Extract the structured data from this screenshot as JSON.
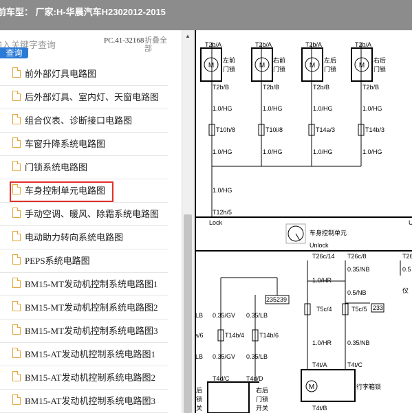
{
  "window": {
    "title": "前车型：  厂家:H-华晨汽车H2302012-2015"
  },
  "search": {
    "placeholder": "输入关键字查询",
    "button_label": "查询"
  },
  "page_code": "PC.41-32168",
  "collapse_label": "折叠全部",
  "tree_items": [
    {
      "label": "前外部灯具电路图",
      "selected": false
    },
    {
      "label": "后外部灯具、室内灯、天窗电路图",
      "selected": false
    },
    {
      "label": "组合仪表、诊断接口电路图",
      "selected": false
    },
    {
      "label": "车窗升降系统电路图",
      "selected": false
    },
    {
      "label": "门锁系统电路图",
      "selected": false
    },
    {
      "label": "车身控制单元电路图",
      "selected": true
    },
    {
      "label": "手动空调、暖风、除霜系统电路图",
      "selected": false
    },
    {
      "label": "电动助力转向系统电路图",
      "selected": false
    },
    {
      "label": "PEPS系统电路图",
      "selected": false
    },
    {
      "label": "BM15-MT发动机控制系统电路图1",
      "selected": false
    },
    {
      "label": "BM15-MT发动机控制系统电路图2",
      "selected": false
    },
    {
      "label": "BM15-MT发动机控制系统电路图3",
      "selected": false
    },
    {
      "label": "BM15-AT发动机控制系统电路图1",
      "selected": false
    },
    {
      "label": "BM15-AT发动机控制系统电路图2",
      "selected": false
    },
    {
      "label": "BM15-AT发动机控制系统电路图3",
      "selected": false
    }
  ],
  "diagram": {
    "motors": [
      {
        "top_pin": "T2b/A",
        "name_l1": "左前",
        "name_l2": "门锁",
        "bottom_pin": "T2b/B",
        "wire1": "1.0/HG",
        "fuse": "T10h/8",
        "wire2": "1.0/HG"
      },
      {
        "top_pin": "T2b/A",
        "name_l1": "右前",
        "name_l2": "门锁",
        "bottom_pin": "T2b/B",
        "wire1": "1.0/HG",
        "fuse": "T10i/8",
        "wire2": "1.0/HG"
      },
      {
        "top_pin": "T2b/A",
        "name_l1": "左后",
        "name_l2": "门锁",
        "bottom_pin": "T2b/B",
        "wire1": "1.0/HG",
        "fuse": "T14a/3",
        "wire2": "1.0/HG"
      },
      {
        "top_pin": "T2b/A",
        "name_l1": "右后",
        "name_l2": "门锁",
        "bottom_pin": "T2b/B",
        "wire1": "1.0/HG",
        "fuse": "T14b/3",
        "wire2": "1.0/HG"
      }
    ],
    "left_wire": "1.0/HG",
    "lock_pin": "T12h/5",
    "lock_label": "Lock",
    "unlock_label": "Unlock",
    "right_u": "U",
    "module_label": "车身控制单元",
    "conn_t26c14": "T26c/14",
    "conn_t26c8": "T26c/8",
    "conn_t26": "T26",
    "wire_035nb_a": "0.35/NB",
    "wire_05": "0.5",
    "wire_10hr_a": "1.0/HR",
    "wire_05nb": "0.5/NB",
    "fuse_t5c4": "T5c/4",
    "fuse_t5c5": "T5c/5",
    "tag_233": "233",
    "tag_235239": "235239",
    "yi": "仪",
    "wire_lb_a": "LB",
    "wire_035gv_a": "0.35/GV",
    "wire_035lb_a": "0.35/LB",
    "pin_a6": "a/6",
    "pin_t14b4": "T14b/4",
    "pin_t14b6": "T14b/6",
    "wire_lb_b": "LB",
    "wire_035gv_b": "0.35/GV",
    "wire_035lb_b": "0.35/LB",
    "wire_10hr_b": "1.0/HR",
    "wire_035nb_b": "0.35/NB",
    "pin_t4ta": "T4t/A",
    "pin_t4tc": "T4t/C",
    "pin_t4dc": "T4d/C",
    "pin_t4dd": "T4d/D",
    "trunk_lock": "行李箱锁",
    "pin_t4tb": "T4t/B",
    "side_l1": "后",
    "side_l2": "锁",
    "side_l3": "关",
    "side_r1": "右后",
    "side_r2": "门锁",
    "side_r3": "开关"
  },
  "colors": {
    "selection_border": "#e0302a",
    "search_button": "#2a7bd6",
    "doc_icon": "#e8a53a"
  }
}
